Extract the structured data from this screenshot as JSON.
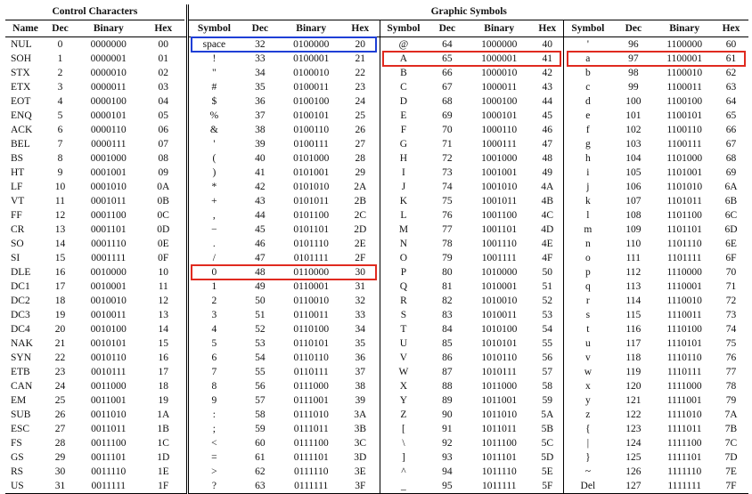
{
  "headers": {
    "control": "Control Characters",
    "graphic": "Graphic Symbols",
    "control_cols": [
      "Name",
      "Dec",
      "Binary",
      "Hex"
    ],
    "graphic_cols": [
      "Symbol",
      "Dec",
      "Binary",
      "Hex"
    ]
  },
  "control": [
    [
      "NUL",
      "0",
      "0000000",
      "00"
    ],
    [
      "SOH",
      "1",
      "0000001",
      "01"
    ],
    [
      "STX",
      "2",
      "0000010",
      "02"
    ],
    [
      "ETX",
      "3",
      "0000011",
      "03"
    ],
    [
      "EOT",
      "4",
      "0000100",
      "04"
    ],
    [
      "ENQ",
      "5",
      "0000101",
      "05"
    ],
    [
      "ACK",
      "6",
      "0000110",
      "06"
    ],
    [
      "BEL",
      "7",
      "0000111",
      "07"
    ],
    [
      "BS",
      "8",
      "0001000",
      "08"
    ],
    [
      "HT",
      "9",
      "0001001",
      "09"
    ],
    [
      "LF",
      "10",
      "0001010",
      "0A"
    ],
    [
      "VT",
      "11",
      "0001011",
      "0B"
    ],
    [
      "FF",
      "12",
      "0001100",
      "0C"
    ],
    [
      "CR",
      "13",
      "0001101",
      "0D"
    ],
    [
      "SO",
      "14",
      "0001110",
      "0E"
    ],
    [
      "SI",
      "15",
      "0001111",
      "0F"
    ],
    [
      "DLE",
      "16",
      "0010000",
      "10"
    ],
    [
      "DC1",
      "17",
      "0010001",
      "11"
    ],
    [
      "DC2",
      "18",
      "0010010",
      "12"
    ],
    [
      "DC3",
      "19",
      "0010011",
      "13"
    ],
    [
      "DC4",
      "20",
      "0010100",
      "14"
    ],
    [
      "NAK",
      "21",
      "0010101",
      "15"
    ],
    [
      "SYN",
      "22",
      "0010110",
      "16"
    ],
    [
      "ETB",
      "23",
      "0010111",
      "17"
    ],
    [
      "CAN",
      "24",
      "0011000",
      "18"
    ],
    [
      "EM",
      "25",
      "0011001",
      "19"
    ],
    [
      "SUB",
      "26",
      "0011010",
      "1A"
    ],
    [
      "ESC",
      "27",
      "0011011",
      "1B"
    ],
    [
      "FS",
      "28",
      "0011100",
      "1C"
    ],
    [
      "GS",
      "29",
      "0011101",
      "1D"
    ],
    [
      "RS",
      "30",
      "0011110",
      "1E"
    ],
    [
      "US",
      "31",
      "0011111",
      "1F"
    ]
  ],
  "graphic1": [
    [
      "space",
      "32",
      "0100000",
      "20"
    ],
    [
      "!",
      "33",
      "0100001",
      "21"
    ],
    [
      "\"",
      "34",
      "0100010",
      "22"
    ],
    [
      "#",
      "35",
      "0100011",
      "23"
    ],
    [
      "$",
      "36",
      "0100100",
      "24"
    ],
    [
      "%",
      "37",
      "0100101",
      "25"
    ],
    [
      "&",
      "38",
      "0100110",
      "26"
    ],
    [
      "'",
      "39",
      "0100111",
      "27"
    ],
    [
      "(",
      "40",
      "0101000",
      "28"
    ],
    [
      ")",
      "41",
      "0101001",
      "29"
    ],
    [
      "*",
      "42",
      "0101010",
      "2A"
    ],
    [
      "+",
      "43",
      "0101011",
      "2B"
    ],
    [
      ",",
      "44",
      "0101100",
      "2C"
    ],
    [
      "−",
      "45",
      "0101101",
      "2D"
    ],
    [
      ".",
      "46",
      "0101110",
      "2E"
    ],
    [
      "/",
      "47",
      "0101111",
      "2F"
    ],
    [
      "0",
      "48",
      "0110000",
      "30"
    ],
    [
      "1",
      "49",
      "0110001",
      "31"
    ],
    [
      "2",
      "50",
      "0110010",
      "32"
    ],
    [
      "3",
      "51",
      "0110011",
      "33"
    ],
    [
      "4",
      "52",
      "0110100",
      "34"
    ],
    [
      "5",
      "53",
      "0110101",
      "35"
    ],
    [
      "6",
      "54",
      "0110110",
      "36"
    ],
    [
      "7",
      "55",
      "0110111",
      "37"
    ],
    [
      "8",
      "56",
      "0111000",
      "38"
    ],
    [
      "9",
      "57",
      "0111001",
      "39"
    ],
    [
      ":",
      "58",
      "0111010",
      "3A"
    ],
    [
      ";",
      "59",
      "0111011",
      "3B"
    ],
    [
      "<",
      "60",
      "0111100",
      "3C"
    ],
    [
      "=",
      "61",
      "0111101",
      "3D"
    ],
    [
      ">",
      "62",
      "0111110",
      "3E"
    ],
    [
      "?",
      "63",
      "0111111",
      "3F"
    ]
  ],
  "graphic2": [
    [
      "@",
      "64",
      "1000000",
      "40"
    ],
    [
      "A",
      "65",
      "1000001",
      "41"
    ],
    [
      "B",
      "66",
      "1000010",
      "42"
    ],
    [
      "C",
      "67",
      "1000011",
      "43"
    ],
    [
      "D",
      "68",
      "1000100",
      "44"
    ],
    [
      "E",
      "69",
      "1000101",
      "45"
    ],
    [
      "F",
      "70",
      "1000110",
      "46"
    ],
    [
      "G",
      "71",
      "1000111",
      "47"
    ],
    [
      "H",
      "72",
      "1001000",
      "48"
    ],
    [
      "I",
      "73",
      "1001001",
      "49"
    ],
    [
      "J",
      "74",
      "1001010",
      "4A"
    ],
    [
      "K",
      "75",
      "1001011",
      "4B"
    ],
    [
      "L",
      "76",
      "1001100",
      "4C"
    ],
    [
      "M",
      "77",
      "1001101",
      "4D"
    ],
    [
      "N",
      "78",
      "1001110",
      "4E"
    ],
    [
      "O",
      "79",
      "1001111",
      "4F"
    ],
    [
      "P",
      "80",
      "1010000",
      "50"
    ],
    [
      "Q",
      "81",
      "1010001",
      "51"
    ],
    [
      "R",
      "82",
      "1010010",
      "52"
    ],
    [
      "S",
      "83",
      "1010011",
      "53"
    ],
    [
      "T",
      "84",
      "1010100",
      "54"
    ],
    [
      "U",
      "85",
      "1010101",
      "55"
    ],
    [
      "V",
      "86",
      "1010110",
      "56"
    ],
    [
      "W",
      "87",
      "1010111",
      "57"
    ],
    [
      "X",
      "88",
      "1011000",
      "58"
    ],
    [
      "Y",
      "89",
      "1011001",
      "59"
    ],
    [
      "Z",
      "90",
      "1011010",
      "5A"
    ],
    [
      "[",
      "91",
      "1011011",
      "5B"
    ],
    [
      "\\",
      "92",
      "1011100",
      "5C"
    ],
    [
      "]",
      "93",
      "1011101",
      "5D"
    ],
    [
      "^",
      "94",
      "1011110",
      "5E"
    ],
    [
      "_",
      "95",
      "1011111",
      "5F"
    ]
  ],
  "graphic3": [
    [
      "'",
      "96",
      "1100000",
      "60"
    ],
    [
      "a",
      "97",
      "1100001",
      "61"
    ],
    [
      "b",
      "98",
      "1100010",
      "62"
    ],
    [
      "c",
      "99",
      "1100011",
      "63"
    ],
    [
      "d",
      "100",
      "1100100",
      "64"
    ],
    [
      "e",
      "101",
      "1100101",
      "65"
    ],
    [
      "f",
      "102",
      "1100110",
      "66"
    ],
    [
      "g",
      "103",
      "1100111",
      "67"
    ],
    [
      "h",
      "104",
      "1101000",
      "68"
    ],
    [
      "i",
      "105",
      "1101001",
      "69"
    ],
    [
      "j",
      "106",
      "1101010",
      "6A"
    ],
    [
      "k",
      "107",
      "1101011",
      "6B"
    ],
    [
      "l",
      "108",
      "1101100",
      "6C"
    ],
    [
      "m",
      "109",
      "1101101",
      "6D"
    ],
    [
      "n",
      "110",
      "1101110",
      "6E"
    ],
    [
      "o",
      "111",
      "1101111",
      "6F"
    ],
    [
      "p",
      "112",
      "1110000",
      "70"
    ],
    [
      "q",
      "113",
      "1110001",
      "71"
    ],
    [
      "r",
      "114",
      "1110010",
      "72"
    ],
    [
      "s",
      "115",
      "1110011",
      "73"
    ],
    [
      "t",
      "116",
      "1110100",
      "74"
    ],
    [
      "u",
      "117",
      "1110101",
      "75"
    ],
    [
      "v",
      "118",
      "1110110",
      "76"
    ],
    [
      "w",
      "119",
      "1110111",
      "77"
    ],
    [
      "x",
      "120",
      "1111000",
      "78"
    ],
    [
      "y",
      "121",
      "1111001",
      "79"
    ],
    [
      "z",
      "122",
      "1111010",
      "7A"
    ],
    [
      "{",
      "123",
      "1111011",
      "7B"
    ],
    [
      "|",
      "124",
      "1111100",
      "7C"
    ],
    [
      "}",
      "125",
      "1111101",
      "7D"
    ],
    [
      "~",
      "126",
      "1111110",
      "7E"
    ],
    [
      "Del",
      "127",
      "1111111",
      "7F"
    ]
  ],
  "highlights": [
    {
      "group": "graphic1",
      "row": 0,
      "color": "#1f3fd6"
    },
    {
      "group": "graphic1",
      "row": 16,
      "color": "#e02a1f"
    },
    {
      "group": "graphic2",
      "row": 1,
      "color": "#e02a1f"
    },
    {
      "group": "graphic3",
      "row": 1,
      "color": "#e02a1f"
    }
  ]
}
